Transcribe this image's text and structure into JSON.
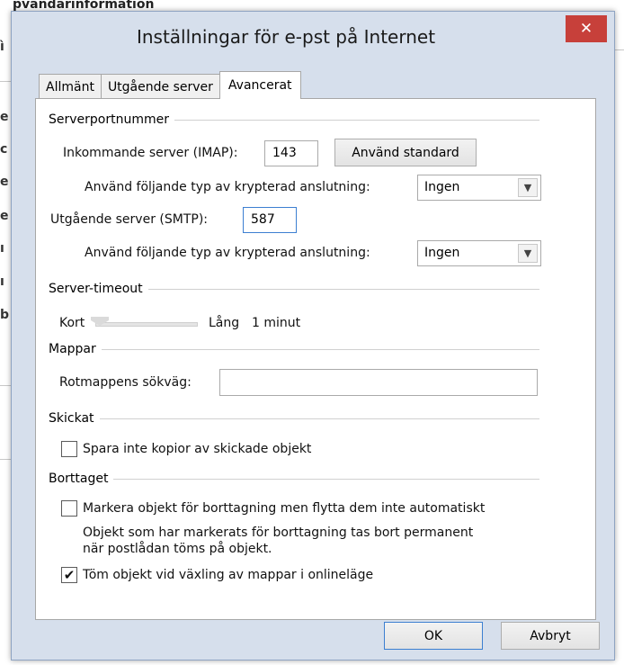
{
  "background": {
    "heading": "pvandarinformation",
    "edge_letters": [
      "ì",
      "e",
      "c",
      "e",
      "e",
      "ı",
      "ı",
      "b"
    ]
  },
  "dialog": {
    "title": "Inställningar för e-pst på Internet",
    "close_glyph": "✕",
    "tabs": [
      "Allmänt",
      "Utgående server",
      "Avancerat"
    ],
    "server_ports": {
      "heading": "Serverportnummer",
      "incoming_label": "Inkommande server (IMAP):",
      "incoming_value": "143",
      "use_default_label": "Använd standard",
      "encryption_label": "Använd följande typ av krypterad anslutning:",
      "incoming_encryption": "Ingen",
      "outgoing_label": "Utgående server (SMTP):",
      "outgoing_value": "587",
      "outgoing_encryption": "Ingen"
    },
    "timeout": {
      "heading": "Server-timeout",
      "short_label": "Kort",
      "long_label": "Lång",
      "value": "1 minut",
      "level": 0
    },
    "folders": {
      "heading": "Mappar",
      "root_label": "Rotmappens sökväg:",
      "root_value": ""
    },
    "sent": {
      "heading": "Skickat",
      "no_copies_label": "Spara inte kopior av skickade objekt",
      "no_copies_checked": false
    },
    "deleted": {
      "heading": "Borttaget",
      "mark_label": "Markera objekt för borttagning men flytta dem inte automatiskt",
      "mark_checked": false,
      "note_line1": "Objekt som har markerats för borttagning tas bort permanent",
      "note_line2": "när postlådan töms på objekt.",
      "purge_label": "Töm objekt vid växling av mappar i onlineläge",
      "purge_checked": true
    },
    "ok_label": "OK",
    "cancel_label": "Avbryt"
  },
  "colors": {
    "close": "#c7403a",
    "focus": "#3c7fd1",
    "frame": "#d6dfec"
  },
  "icons": {
    "close": "close-icon",
    "dropdown": "chevron-down-icon",
    "check": "checkmark-icon"
  }
}
